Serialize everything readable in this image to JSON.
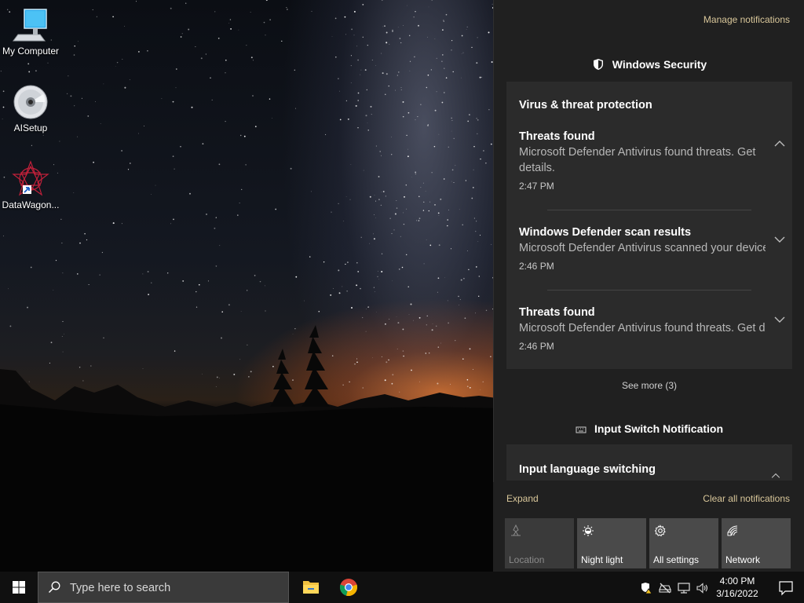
{
  "desktop": {
    "icons": [
      {
        "label": "My Computer",
        "icon": "computer-icon"
      },
      {
        "label": "AISetup",
        "icon": "cd-disc-icon"
      },
      {
        "label": "DataWagon...",
        "icon": "datawagon-shortcut-icon"
      }
    ]
  },
  "action_center": {
    "manage_link": "Manage notifications",
    "groups": [
      {
        "app": "Windows Security",
        "icon": "shield-icon",
        "category": "Virus & threat protection",
        "notifications": [
          {
            "title": "Threats found",
            "body": "Microsoft Defender Antivirus found threats. Get details.",
            "time": "2:47 PM",
            "expanded": true
          },
          {
            "title": "Windows Defender scan results",
            "body": "Microsoft Defender Antivirus scanned your device",
            "time": "2:46 PM",
            "expanded": false
          },
          {
            "title": "Threats found",
            "body": "Microsoft Defender Antivirus found threats. Get details.",
            "time": "2:46 PM",
            "expanded": false
          }
        ],
        "see_more": "See more (3)"
      },
      {
        "app": "Input Switch Notification",
        "icon": "keyboard-icon",
        "category": "Input language switching"
      }
    ],
    "expand_label": "Expand",
    "clear_label": "Clear all notifications",
    "quick_actions": [
      {
        "label": "Location",
        "icon": "location-icon",
        "enabled": false
      },
      {
        "label": "Night light",
        "icon": "night-light-icon",
        "enabled": true
      },
      {
        "label": "All settings",
        "icon": "gear-icon",
        "enabled": true
      },
      {
        "label": "Network",
        "icon": "network-icon",
        "enabled": true
      }
    ]
  },
  "taskbar": {
    "search_placeholder": "Type here to search",
    "pinned_apps": [
      "file-explorer-icon",
      "chrome-icon"
    ],
    "tray_icons": [
      "defender-warning-icon",
      "disconnected-drive-icon",
      "network-monitor-icon",
      "volume-icon"
    ],
    "time": "4:00 PM",
    "date": "3/16/2022"
  },
  "colors": {
    "accent_link": "#d9c79a",
    "panel_bg": "#202020",
    "card_bg": "#2b2b2b",
    "taskbar_bg": "#101010"
  }
}
